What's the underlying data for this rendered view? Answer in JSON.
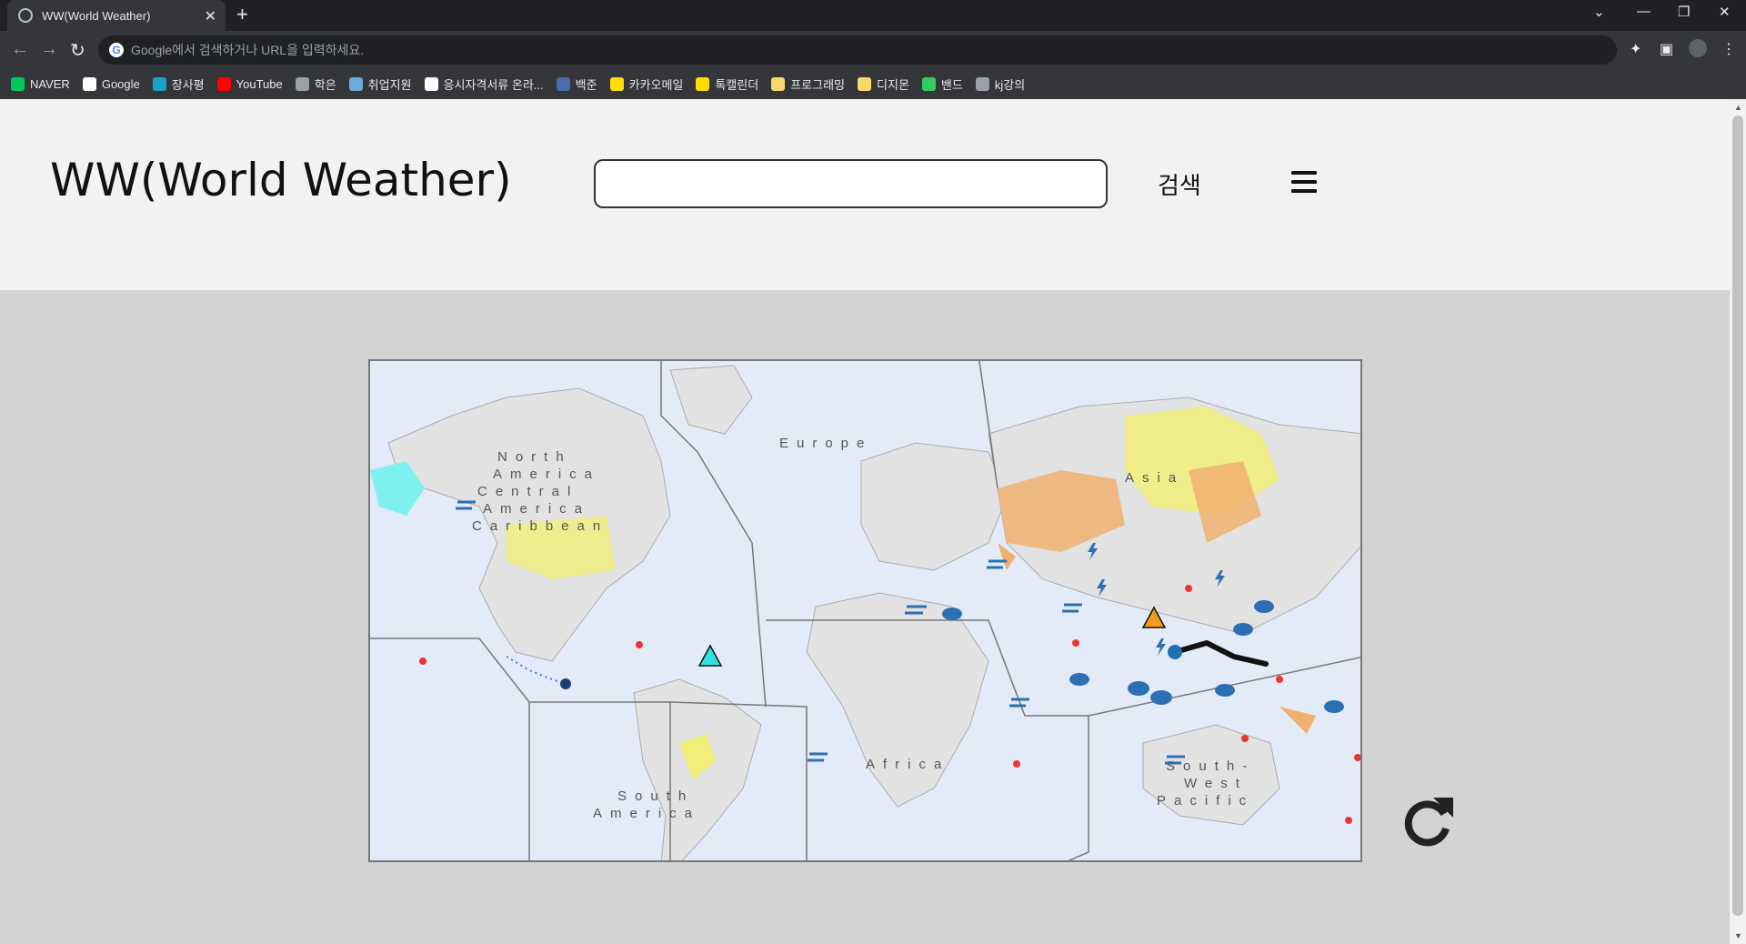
{
  "browser": {
    "tab_title": "WW(World Weather)",
    "omnibox_placeholder": "Google에서 검색하거나 URL을 입력하세요.",
    "bookmarks": [
      {
        "label": "NAVER",
        "color": "#03c75a"
      },
      {
        "label": "Google",
        "color": "#ffffff"
      },
      {
        "label": "장사평",
        "color": "#1aa3c9"
      },
      {
        "label": "YouTube",
        "color": "#ff0000"
      },
      {
        "label": "학은",
        "color": "#9aa0a6"
      },
      {
        "label": "취업지원",
        "color": "#6fa8dc"
      },
      {
        "label": "응시자격서류 온라...",
        "color": "#ffffff"
      },
      {
        "label": "백준",
        "color": "#4a6ea9"
      },
      {
        "label": "카카오메일",
        "color": "#ffdd00"
      },
      {
        "label": "톡캘린더",
        "color": "#ffdd00"
      },
      {
        "label": "프로그래밍",
        "color": "#f6d96b"
      },
      {
        "label": "디지몬",
        "color": "#f6d96b"
      },
      {
        "label": "밴드",
        "color": "#33cc66"
      },
      {
        "label": "kj강의",
        "color": "#9aa0a6"
      }
    ]
  },
  "site": {
    "title": "WW(World Weather)",
    "search_value": "",
    "search_button": "검색"
  },
  "map": {
    "regions": {
      "north_america": [
        "North",
        "America",
        "Central",
        "America",
        "Caribbean"
      ],
      "europe": "Europe",
      "asia": "Asia",
      "africa": "Africa",
      "south_america": [
        "South",
        "America"
      ],
      "south_west_pacific": [
        "South-",
        "West",
        "Pacific"
      ]
    }
  },
  "colors": {
    "header_bg": "#f2f2f2",
    "page_bg": "#d3d3d3",
    "map_ocean": "#e3ebf8",
    "map_land": "#e2e2e2",
    "warn_yellow": "#f2f07a",
    "warn_orange": "#f0b070",
    "warn_cyan": "#7ff0f0"
  }
}
